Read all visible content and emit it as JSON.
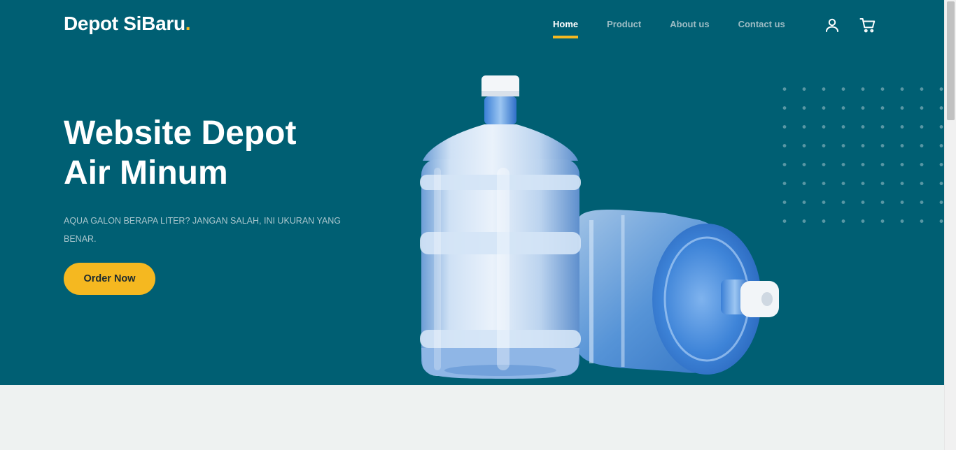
{
  "brand": {
    "name": "Depot SiBaru",
    "dot": "."
  },
  "nav": {
    "items": [
      {
        "label": "Home",
        "active": true
      },
      {
        "label": "Product",
        "active": false
      },
      {
        "label": "About us",
        "active": false
      },
      {
        "label": "Contact us",
        "active": false
      }
    ],
    "icons": [
      "user-icon",
      "cart-icon"
    ]
  },
  "hero": {
    "headline_line1": "Website Depot",
    "headline_line2": "Air Minum",
    "subtitle": "AQUA GALON BERAPA LITER? JANGAN SALAH, INI UKURAN YANG BENAR.",
    "cta_label": "Order Now",
    "image": "water-gallon-bottles"
  },
  "colors": {
    "hero_background": "#005f73",
    "accent": "#f5b820",
    "page_background": "#eef2f1"
  }
}
